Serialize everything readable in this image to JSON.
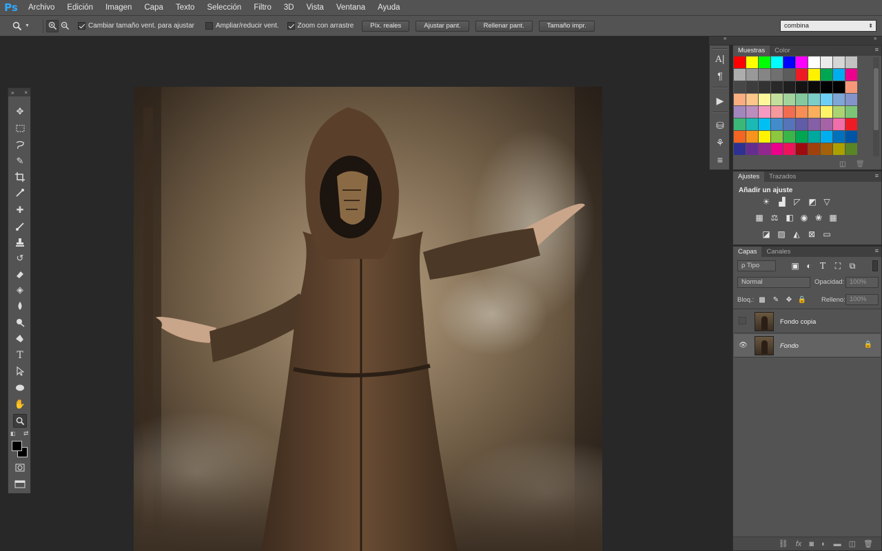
{
  "app": {
    "logo": "Ps"
  },
  "menu": [
    "Archivo",
    "Edición",
    "Imagen",
    "Capa",
    "Texto",
    "Selección",
    "Filtro",
    "3D",
    "Vista",
    "Ventana",
    "Ayuda"
  ],
  "options": {
    "chk_resize": "Cambiar tamaño vent. para ajustar",
    "chk_zoom_all": "Ampliar/reducir vent.",
    "chk_scrubby": "Zoom con arrastre",
    "btn_actual": "Píx. reales",
    "btn_fit": "Ajustar pant.",
    "btn_fill": "Rellenar pant.",
    "btn_print": "Tamaño impr.",
    "workspace": "combina"
  },
  "panels": {
    "swatches": {
      "tab1": "Muestras",
      "tab2": "Color"
    },
    "adjust": {
      "tab1": "Ajustes",
      "tab2": "Trazados",
      "title": "Añadir un ajuste"
    },
    "layers": {
      "tab1": "Capas",
      "tab2": "Canales",
      "filter": "ρ Tipo",
      "blend": "Normal",
      "opacity_label": "Opacidad:",
      "opacity_value": "100%",
      "lock_label": "Bloq.:",
      "fill_label": "Relleno:",
      "fill_value": "100%",
      "items": [
        {
          "name": "Fondo copia"
        },
        {
          "name": "Fondo"
        }
      ]
    }
  },
  "colors": {
    "accent": "#31a8ff",
    "swatch_rows": [
      [
        "#ff0000",
        "#ffff00",
        "#00ff00",
        "#00ffff",
        "#0000ff",
        "#ff00ff",
        "#ffffff",
        "#ebebeb",
        "#d6d6d6",
        "#c2c2c2"
      ],
      [
        "#adadad",
        "#999999",
        "#858585",
        "#707070",
        "#5c5c5c",
        "#ed1c24",
        "#fff200",
        "#00a651",
        "#00aeef",
        "#ec008c"
      ],
      [
        "#474747",
        "#3d3d3d",
        "#333333",
        "#292929",
        "#1f1f1f",
        "#141414",
        "#0a0a0a",
        "#000000",
        "#000000",
        "#f7977a"
      ],
      [
        "#f9ad81",
        "#fdc68a",
        "#fff79a",
        "#c4df9b",
        "#a3d39c",
        "#82ca9d",
        "#7bcdc8",
        "#6ecff6",
        "#7ea7d8",
        "#8493ca"
      ],
      [
        "#a187be",
        "#bc8dbf",
        "#f49ac2",
        "#f6989d",
        "#f26c4f",
        "#f68e55",
        "#fbaf5c",
        "#fff467",
        "#acd372",
        "#7cc576"
      ],
      [
        "#3bb878",
        "#1abbb4",
        "#00bff3",
        "#438ccb",
        "#5574b9",
        "#605ca8",
        "#855fa8",
        "#a763a8",
        "#f06eaa",
        "#ed1c24"
      ],
      [
        "#f26522",
        "#f7941d",
        "#fff200",
        "#8dc73f",
        "#39b54a",
        "#00a651",
        "#00a99d",
        "#00aeef",
        "#0072bc",
        "#0054a6"
      ],
      [
        "#2e3192",
        "#662d91",
        "#92278f",
        "#ec008c",
        "#ed145b",
        "#9e0b0f",
        "#a0410d",
        "#a36209",
        "#aba000",
        "#598527"
      ]
    ]
  }
}
